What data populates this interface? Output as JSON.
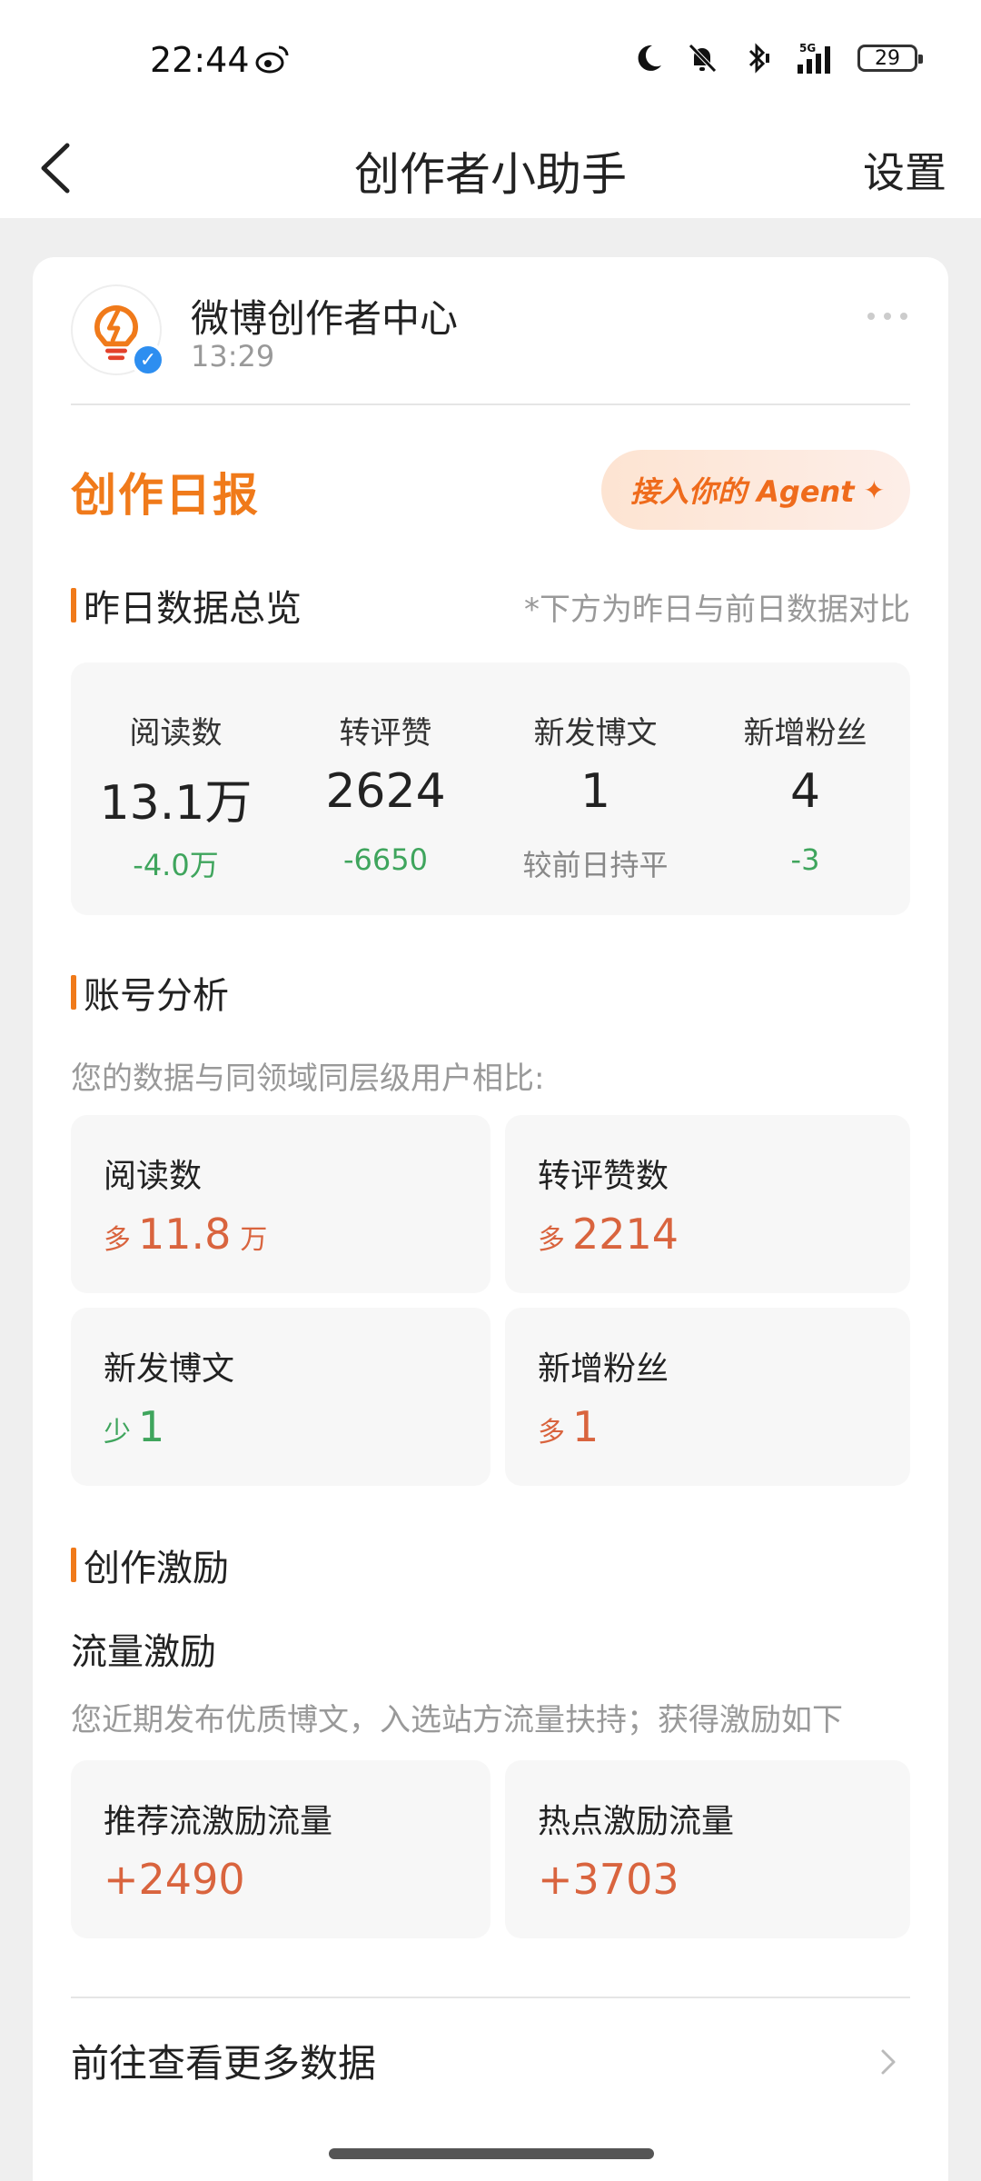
{
  "status_bar": {
    "time": "22:44",
    "battery": "29",
    "icons": [
      "weibo-icon",
      "moon-icon",
      "bell-off-icon",
      "bluetooth-icon",
      "signal-5g-icon",
      "battery-icon"
    ]
  },
  "nav": {
    "title": "创作者小助手",
    "settings": "设置"
  },
  "account": {
    "name": "微博创作者中心",
    "time": "13:29"
  },
  "report": {
    "title": "创作日报",
    "agent_button": "接入你的 Agent"
  },
  "overview": {
    "title": "昨日数据总览",
    "note": "*下方为昨日与前日数据对比",
    "stats": [
      {
        "label": "阅读数",
        "value": "13.1万",
        "delta": "-4.0万"
      },
      {
        "label": "转评赞",
        "value": "2624",
        "delta": "-6650"
      },
      {
        "label": "新发博文",
        "value": "1",
        "delta": "较前日持平"
      },
      {
        "label": "新增粉丝",
        "value": "4",
        "delta": "-3"
      }
    ]
  },
  "analysis": {
    "title": "账号分析",
    "subtitle": "您的数据与同领域同层级用户相比:",
    "tiles": [
      {
        "label": "阅读数",
        "prefix": "多",
        "value": "11.8",
        "suffix": "万"
      },
      {
        "label": "转评赞数",
        "prefix": "多",
        "value": "2214",
        "suffix": ""
      },
      {
        "label": "新发博文",
        "prefix": "少",
        "value": "1",
        "suffix": ""
      },
      {
        "label": "新增粉丝",
        "prefix": "多",
        "value": "1",
        "suffix": ""
      }
    ]
  },
  "incentive": {
    "title": "创作激励",
    "subtitle": "流量激励",
    "desc": "您近期发布优质博文，入选站方流量扶持；获得激励如下",
    "tiles": [
      {
        "label": "推荐流激励流量",
        "value": "+2490"
      },
      {
        "label": "热点激励流量",
        "value": "+3703"
      }
    ]
  },
  "more_link": "前往查看更多数据",
  "colors": {
    "accent": "#f07a1a",
    "up": "#d9643e",
    "down": "#3fa55d",
    "verified": "#2d8ef0"
  }
}
